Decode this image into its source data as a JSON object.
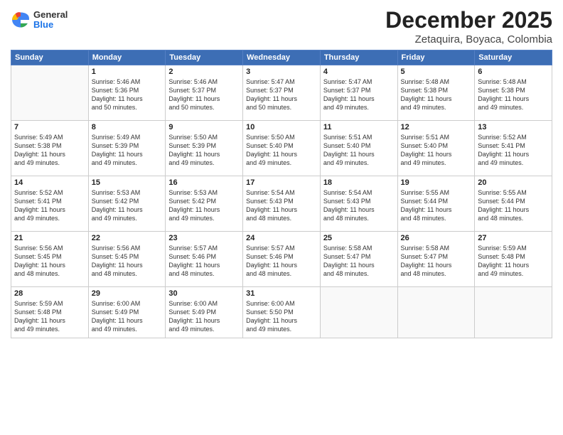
{
  "header": {
    "logo": {
      "general": "General",
      "blue": "Blue"
    },
    "title": "December 2025",
    "subtitle": "Zetaquira, Boyaca, Colombia"
  },
  "days_of_week": [
    "Sunday",
    "Monday",
    "Tuesday",
    "Wednesday",
    "Thursday",
    "Friday",
    "Saturday"
  ],
  "weeks": [
    [
      {
        "day": "",
        "info": ""
      },
      {
        "day": "1",
        "info": "Sunrise: 5:46 AM\nSunset: 5:36 PM\nDaylight: 11 hours\nand 50 minutes."
      },
      {
        "day": "2",
        "info": "Sunrise: 5:46 AM\nSunset: 5:37 PM\nDaylight: 11 hours\nand 50 minutes."
      },
      {
        "day": "3",
        "info": "Sunrise: 5:47 AM\nSunset: 5:37 PM\nDaylight: 11 hours\nand 50 minutes."
      },
      {
        "day": "4",
        "info": "Sunrise: 5:47 AM\nSunset: 5:37 PM\nDaylight: 11 hours\nand 49 minutes."
      },
      {
        "day": "5",
        "info": "Sunrise: 5:48 AM\nSunset: 5:38 PM\nDaylight: 11 hours\nand 49 minutes."
      },
      {
        "day": "6",
        "info": "Sunrise: 5:48 AM\nSunset: 5:38 PM\nDaylight: 11 hours\nand 49 minutes."
      }
    ],
    [
      {
        "day": "7",
        "info": "Sunrise: 5:49 AM\nSunset: 5:38 PM\nDaylight: 11 hours\nand 49 minutes."
      },
      {
        "day": "8",
        "info": "Sunrise: 5:49 AM\nSunset: 5:39 PM\nDaylight: 11 hours\nand 49 minutes."
      },
      {
        "day": "9",
        "info": "Sunrise: 5:50 AM\nSunset: 5:39 PM\nDaylight: 11 hours\nand 49 minutes."
      },
      {
        "day": "10",
        "info": "Sunrise: 5:50 AM\nSunset: 5:40 PM\nDaylight: 11 hours\nand 49 minutes."
      },
      {
        "day": "11",
        "info": "Sunrise: 5:51 AM\nSunset: 5:40 PM\nDaylight: 11 hours\nand 49 minutes."
      },
      {
        "day": "12",
        "info": "Sunrise: 5:51 AM\nSunset: 5:40 PM\nDaylight: 11 hours\nand 49 minutes."
      },
      {
        "day": "13",
        "info": "Sunrise: 5:52 AM\nSunset: 5:41 PM\nDaylight: 11 hours\nand 49 minutes."
      }
    ],
    [
      {
        "day": "14",
        "info": "Sunrise: 5:52 AM\nSunset: 5:41 PM\nDaylight: 11 hours\nand 49 minutes."
      },
      {
        "day": "15",
        "info": "Sunrise: 5:53 AM\nSunset: 5:42 PM\nDaylight: 11 hours\nand 49 minutes."
      },
      {
        "day": "16",
        "info": "Sunrise: 5:53 AM\nSunset: 5:42 PM\nDaylight: 11 hours\nand 49 minutes."
      },
      {
        "day": "17",
        "info": "Sunrise: 5:54 AM\nSunset: 5:43 PM\nDaylight: 11 hours\nand 48 minutes."
      },
      {
        "day": "18",
        "info": "Sunrise: 5:54 AM\nSunset: 5:43 PM\nDaylight: 11 hours\nand 48 minutes."
      },
      {
        "day": "19",
        "info": "Sunrise: 5:55 AM\nSunset: 5:44 PM\nDaylight: 11 hours\nand 48 minutes."
      },
      {
        "day": "20",
        "info": "Sunrise: 5:55 AM\nSunset: 5:44 PM\nDaylight: 11 hours\nand 48 minutes."
      }
    ],
    [
      {
        "day": "21",
        "info": "Sunrise: 5:56 AM\nSunset: 5:45 PM\nDaylight: 11 hours\nand 48 minutes."
      },
      {
        "day": "22",
        "info": "Sunrise: 5:56 AM\nSunset: 5:45 PM\nDaylight: 11 hours\nand 48 minutes."
      },
      {
        "day": "23",
        "info": "Sunrise: 5:57 AM\nSunset: 5:46 PM\nDaylight: 11 hours\nand 48 minutes."
      },
      {
        "day": "24",
        "info": "Sunrise: 5:57 AM\nSunset: 5:46 PM\nDaylight: 11 hours\nand 48 minutes."
      },
      {
        "day": "25",
        "info": "Sunrise: 5:58 AM\nSunset: 5:47 PM\nDaylight: 11 hours\nand 48 minutes."
      },
      {
        "day": "26",
        "info": "Sunrise: 5:58 AM\nSunset: 5:47 PM\nDaylight: 11 hours\nand 48 minutes."
      },
      {
        "day": "27",
        "info": "Sunrise: 5:59 AM\nSunset: 5:48 PM\nDaylight: 11 hours\nand 49 minutes."
      }
    ],
    [
      {
        "day": "28",
        "info": "Sunrise: 5:59 AM\nSunset: 5:48 PM\nDaylight: 11 hours\nand 49 minutes."
      },
      {
        "day": "29",
        "info": "Sunrise: 6:00 AM\nSunset: 5:49 PM\nDaylight: 11 hours\nand 49 minutes."
      },
      {
        "day": "30",
        "info": "Sunrise: 6:00 AM\nSunset: 5:49 PM\nDaylight: 11 hours\nand 49 minutes."
      },
      {
        "day": "31",
        "info": "Sunrise: 6:00 AM\nSunset: 5:50 PM\nDaylight: 11 hours\nand 49 minutes."
      },
      {
        "day": "",
        "info": ""
      },
      {
        "day": "",
        "info": ""
      },
      {
        "day": "",
        "info": ""
      }
    ]
  ]
}
